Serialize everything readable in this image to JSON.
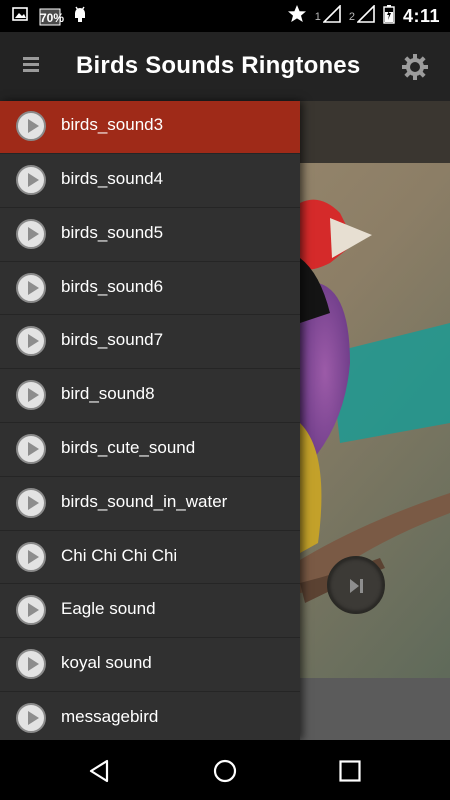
{
  "status_bar": {
    "battery_text": "70%",
    "sim1": "1",
    "sim2": "2",
    "time": "4:11"
  },
  "app_bar": {
    "title": "Birds Sounds Ringtones",
    "menu_icon": "hamburger-icon",
    "settings_icon": "gear-icon"
  },
  "sounds": [
    {
      "label": "birds_sound3",
      "active": true
    },
    {
      "label": "birds_sound4",
      "active": false
    },
    {
      "label": "birds_sound5",
      "active": false
    },
    {
      "label": "birds_sound6",
      "active": false
    },
    {
      "label": "birds_sound7",
      "active": false
    },
    {
      "label": "bird_sound8",
      "active": false
    },
    {
      "label": "birds_cute_sound",
      "active": false
    },
    {
      "label": "birds_sound_in_water",
      "active": false
    },
    {
      "label": "Chi Chi Chi Chi",
      "active": false
    },
    {
      "label": "Eagle sound",
      "active": false
    },
    {
      "label": "koyal sound",
      "active": false
    },
    {
      "label": "messagebird",
      "active": false
    }
  ],
  "colors": {
    "active_item": "#9f2a18",
    "drawer_bg": "#303030",
    "app_bar_bg": "#232323"
  }
}
